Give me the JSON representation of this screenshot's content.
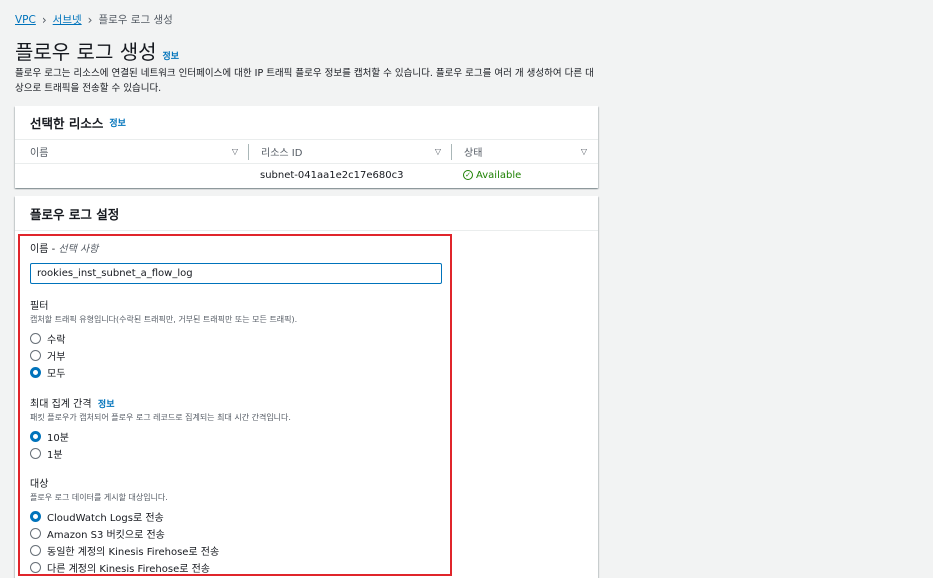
{
  "breadcrumb": {
    "vpc": "VPC",
    "subnets": "서브넷",
    "current": "플로우 로그 생성"
  },
  "page": {
    "title": "플로우 로그 생성",
    "info": "정보",
    "description": "플로우 로그는 리소스에 연결된 네트워크 인터페이스에 대한 IP 트래픽 플로우 정보를 캡처할 수 있습니다. 플로우 로그를 여러 개 생성하여 다른 대상으로 트래픽을 전송할 수 있습니다."
  },
  "resources": {
    "title": "선택한 리소스",
    "info": "정보",
    "columns": [
      "이름",
      "리소스 ID",
      "상태"
    ],
    "rows": [
      {
        "name": "",
        "resource_id": "subnet-041aa1e2c17e680c3",
        "status": "Available"
      }
    ]
  },
  "settings": {
    "title": "플로우 로그 설정",
    "name_label": "이름 - ",
    "name_optional": "선택 사항",
    "name_value": "rookies_inst_subnet_a_flow_log",
    "filter": {
      "label": "필터",
      "desc": "캡처할 트래픽 유형입니다(수락된 트래픽만, 거부된 트래픽만 또는 모든 트래픽).",
      "options": [
        "수락",
        "거부",
        "모두"
      ],
      "selected": "모두"
    },
    "interval": {
      "label": "최대 집계 간격",
      "info": "정보",
      "desc": "패킷 플로우가 캡처되어 플로우 로그 레코드로 집계되는 최대 시간 간격입니다.",
      "options": [
        "10분",
        "1분"
      ],
      "selected": "10분"
    },
    "destination": {
      "label": "대상",
      "desc": "플로우 로그 데이터를 게시할 대상입니다.",
      "options": [
        "CloudWatch Logs로 전송",
        "Amazon S3 버킷으로 전송",
        "동일한 계정의 Kinesis Firehose로 전송",
        "다른 계정의 Kinesis Firehose로 전송"
      ],
      "selected": "CloudWatch Logs로 전송"
    }
  },
  "colors": {
    "link": "#0073bb",
    "success": "#1d8102",
    "highlight": "#e0252b"
  }
}
